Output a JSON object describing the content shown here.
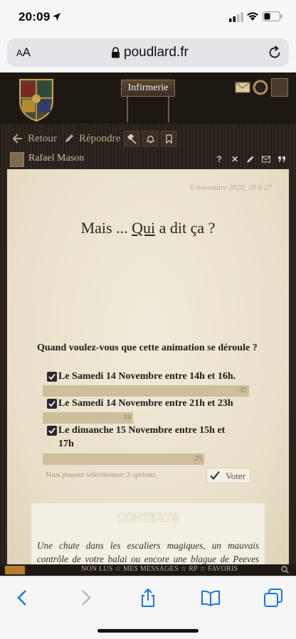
{
  "status_bar": {
    "time": "20:09"
  },
  "browser": {
    "aa_label_small": "A",
    "aa_label_large": "A",
    "domain": "poudlard.fr"
  },
  "forum": {
    "section_button": "Infirmerie",
    "toolbar": {
      "back": "Retour",
      "reply": "Répondre"
    },
    "author": {
      "name": "Rafael Mason",
      "actions": [
        "?",
        "✕"
      ]
    }
  },
  "post": {
    "date": "6 novembre 2020, 20 h 27",
    "title_before": "Mais ... ",
    "title_underlined": "Qui",
    "title_after": " a dit ça ?",
    "poll": {
      "question": "Quand voulez-vous que cette animation se déroule ?",
      "options": [
        {
          "label": "Le Samedi 14 Novembre entre 14h et 16h.",
          "votes": "32",
          "share": 1.0
        },
        {
          "label": "Le Samedi 14 Novembre entre 21h et 23h",
          "votes": "14",
          "share": 0.4375
        },
        {
          "label": "Le dimanche 15 Novembre entre 15h et 17h",
          "votes": "25",
          "share": 0.78125
        }
      ],
      "hint": "Vous pouvez sélectionner 3 options.",
      "vote_label": "Voter"
    },
    "context": {
      "title": "CONTEXTE",
      "text": "Une chute dans les escaliers magiques, un mauvais contrôle de votre balai ou encore une blague de Peeves qui a mal tourné, les raisons sont nombreuses à Poudlard pour finir avec un traumatisme. Ce week-end là, Rafael l'avait bien remarqué. Beaucoup d'élèves s'étaient retrouvés à l'infirmerie et bon nombre d'entre eux avaient une luxation, mineure ou majeure, des plaies importantes"
    }
  },
  "forum_nav": {
    "text": "NON LUS ☆ MES MESSAGES ☆ RP ☆ FAVORIS"
  }
}
